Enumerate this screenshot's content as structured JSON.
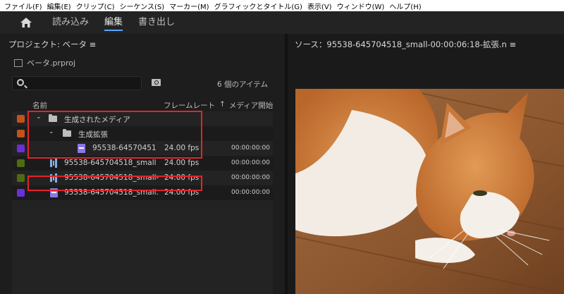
{
  "menu": [
    "ファイル(F)",
    "編集(E)",
    "クリップ(C)",
    "シーケンス(S)",
    "マーカー(M)",
    "グラフィックとタイトル(G)",
    "表示(V)",
    "ウィンドウ(W)",
    "ヘルプ(H)"
  ],
  "workspace": {
    "tabs": [
      {
        "label": "読み込み"
      },
      {
        "label": "編集"
      },
      {
        "label": "書き出し"
      }
    ],
    "active_tab": "編集"
  },
  "project": {
    "title": "プロジェクト: ベータ ≡",
    "file": "ベータ.prproj",
    "search_placeholder": "",
    "item_count": "6 個のアイテム",
    "columns": {
      "name": "名前",
      "frame_rate": "フレームレート",
      "sort_arrow": "↑",
      "media_start": "メディア開始"
    },
    "rows": [
      {
        "type": "folder",
        "indent": 0,
        "expanded": true,
        "name": "生成されたメディア",
        "fps": "",
        "start": "",
        "label_color": "#c0531c"
      },
      {
        "type": "folder",
        "indent": 1,
        "expanded": true,
        "name": "生成拡張",
        "fps": "",
        "start": "",
        "label_color": "#c0531c"
      },
      {
        "type": "clip",
        "indent": 2,
        "name": "95538-64570451",
        "fps": "24.00 fps",
        "start": "00:00:00:00",
        "label_color": "#6a2fd9"
      },
      {
        "type": "sequence",
        "indent": 0,
        "name": "95538-645704518_small",
        "fps": "24.00 fps",
        "start": "00:00:00:00",
        "label_color": "#4f6b12"
      },
      {
        "type": "sequence",
        "indent": 0,
        "name": "95538-645704518_small-",
        "fps": "24.00 fps",
        "start": "00:00:00:00",
        "label_color": "#4f6b12"
      },
      {
        "type": "clip",
        "indent": 0,
        "name": "95538-645704518_small.",
        "fps": "24.00 fps",
        "start": "00:00:00:00",
        "label_color": "#6a2fd9"
      }
    ]
  },
  "source": {
    "title": "ソース：95538-645704518_small-00:00:06:18-拡張.n ≡"
  },
  "colors": {
    "highlight": "#e3242b",
    "accent": "#5aa5ff"
  }
}
